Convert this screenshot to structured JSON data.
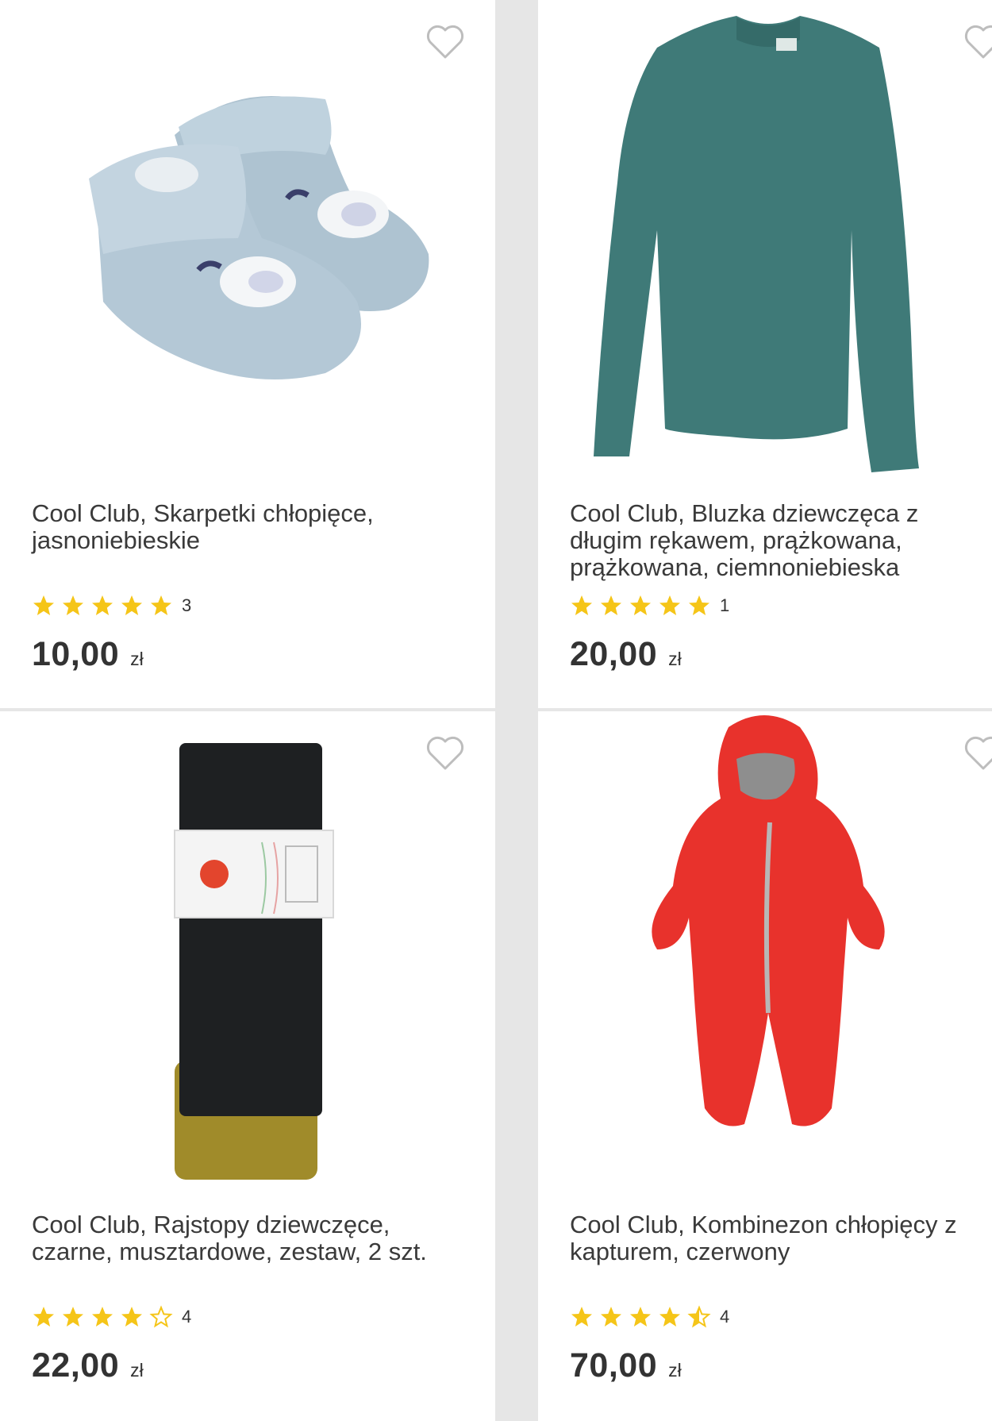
{
  "products": [
    {
      "title": "Cool Club, Skarpetki chłopięce, jasnoniebieskie",
      "rating": 5,
      "reviews": "3",
      "price": "10,00",
      "currency": "zł",
      "image": "light-blue-baby-socks"
    },
    {
      "title": "Cool Club, Bluzka dziewczęca z długim rękawem, prążkowana, prążkowana, ciemnoniebieska",
      "rating": 5,
      "reviews": "1",
      "price": "20,00",
      "currency": "zł",
      "image": "teal-long-sleeve-top"
    },
    {
      "title": "Cool Club, Rajstopy dziewczęce, czarne, musztardowe, zestaw, 2 szt.",
      "rating": 4,
      "reviews": "4",
      "price": "22,00",
      "currency": "zł",
      "image": "black-and-mustard-tights"
    },
    {
      "title": "Cool Club, Kombinezon chłopięcy z kapturem, czerwony",
      "rating": 4.5,
      "reviews": "4",
      "price": "70,00",
      "currency": "zł",
      "image": "red-hooded-snowsuit"
    }
  ],
  "colors": {
    "star": "#f5c518",
    "star_empty_stroke": "#f5c518",
    "heart_stroke": "#bdbdbd",
    "card_bg": "#ffffff",
    "gap": "#e6e6e6",
    "text": "#3a3a3a"
  }
}
